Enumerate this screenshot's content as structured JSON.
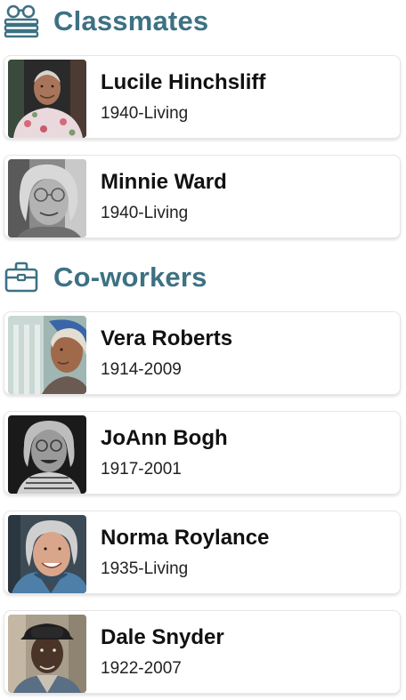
{
  "sections": [
    {
      "title": "Classmates",
      "icon": "glasses-books-icon",
      "people": [
        {
          "name": "Lucile Hinchsliff",
          "years": "1940-Living"
        },
        {
          "name": "Minnie Ward",
          "years": "1940-Living"
        }
      ]
    },
    {
      "title": "Co-workers",
      "icon": "briefcase-icon",
      "people": [
        {
          "name": "Vera Roberts",
          "years": "1914-2009"
        },
        {
          "name": "JoAnn Bogh",
          "years": "1917-2001"
        },
        {
          "name": "Norma Roylance",
          "years": "1935-Living"
        },
        {
          "name": "Dale Snyder",
          "years": "1922-2007"
        }
      ]
    }
  ],
  "colors": {
    "section_title": "#3d7184",
    "card_border": "#e6e6e6",
    "text": "#111111"
  }
}
